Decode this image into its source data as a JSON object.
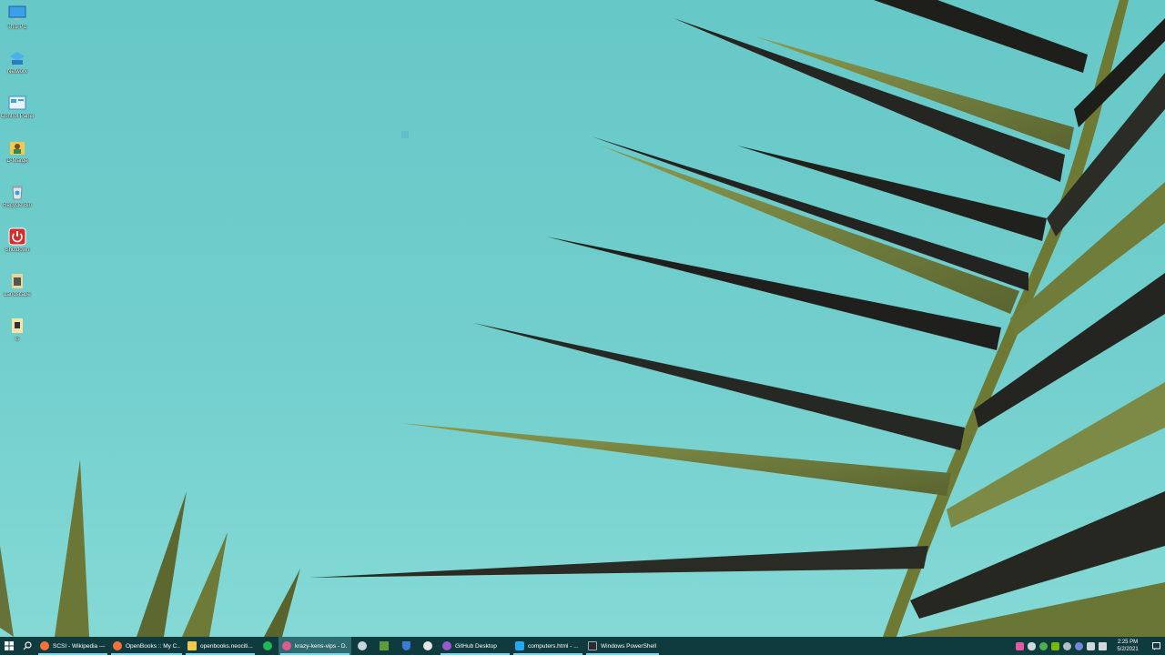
{
  "desktop": {
    "icons": [
      {
        "label": "This PC"
      },
      {
        "label": "Network"
      },
      {
        "label": "Control Panel"
      },
      {
        "label": "D-Marge"
      },
      {
        "label": "Recycle Bin"
      },
      {
        "label": "Shutdown"
      },
      {
        "label": "Landscape"
      },
      {
        "label": "B"
      }
    ]
  },
  "taskbar": {
    "apps": [
      {
        "label": "SCSI - Wikipedia —...",
        "icon": "firefox-icon",
        "color": "#ff7139"
      },
      {
        "label": "OpenBooks :: My C...",
        "icon": "firefox-icon",
        "color": "#ff7139"
      },
      {
        "label": "openbooks.neociti...",
        "icon": "folder-icon",
        "color": "#f2c94c"
      },
      {
        "label": "krazy-kens-vips - D...",
        "icon": "app-icon",
        "color": "#e05a8c"
      },
      {
        "label": "GitHub Desktop",
        "icon": "github-icon",
        "color": "#9b59d0"
      },
      {
        "label": "computers.html - ...",
        "icon": "vscode-icon",
        "color": "#23a9f2"
      },
      {
        "label": "Windows PowerShell",
        "icon": "powershell-icon",
        "color": "#2b2b2b"
      }
    ],
    "pinned": [
      {
        "icon": "spotify-icon",
        "color": "#1db954"
      },
      {
        "icon": "steam-icon",
        "color": "#c7d5e0"
      },
      {
        "icon": "minecraft-icon",
        "color": "#5f9b3b"
      },
      {
        "icon": "shield-icon",
        "color": "#3a7bd5"
      },
      {
        "icon": "github-cat-icon",
        "color": "#e6e6e6"
      }
    ],
    "clock": {
      "time": "2:25 PM",
      "date": "5/2/2021"
    }
  }
}
